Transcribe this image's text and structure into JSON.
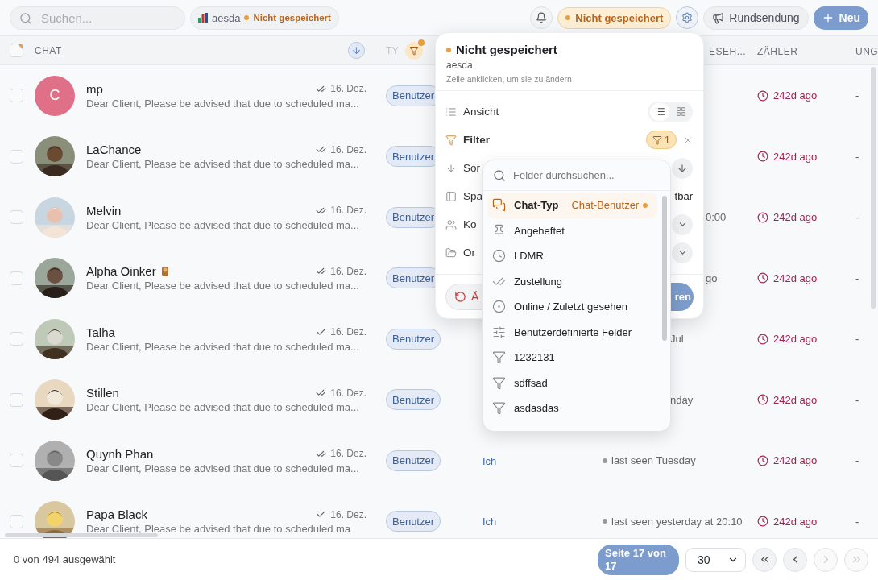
{
  "search": {
    "placeholder": "Suchen..."
  },
  "view_chip": {
    "name": "aesda",
    "status": "Nicht gespeichert"
  },
  "toolbar": {
    "status": "Nicht gespeichert",
    "broadcast": "Rundsendung",
    "new": "Neu"
  },
  "table": {
    "select_all": {
      "checked": false
    },
    "columns": [
      {
        "label": "CHAT"
      },
      {
        "label": "TY"
      },
      {
        "label": "ESEH..."
      },
      {
        "label": "ZÄHLER"
      },
      {
        "label": "UNG"
      }
    ],
    "rows": [
      {
        "checked": false,
        "name": "mp",
        "avatar": {
          "kind": "initial",
          "text": "C",
          "color": "#e07088"
        },
        "sticker": false,
        "double_check": true,
        "date": "16. Dez.",
        "preview": "Dear Client, Please be advised that due to scheduled ma...",
        "type": "Benutzer",
        "counter": "242d ago",
        "unread": "-"
      },
      {
        "checked": false,
        "name": "LaChance",
        "sticker": false,
        "double_check": true,
        "date": "16. Dez.",
        "preview": "Dear Client, Please be advised that due to scheduled ma...",
        "type": "Benutzer",
        "counter": "242d ago",
        "unread": "-"
      },
      {
        "checked": false,
        "name": "Melvin",
        "sticker": false,
        "double_check": true,
        "date": "16. Dez.",
        "preview": "Dear Client, Please be advised that due to scheduled ma...",
        "type": "Benutzer",
        "seen": {
          "text": "0:00",
          "dot": false
        },
        "counter": "242d ago",
        "unread": "-"
      },
      {
        "checked": false,
        "name": "Alpha Oinker",
        "sticker": true,
        "double_check": true,
        "date": "16. Dez.",
        "preview": "Dear Client, Please be advised that due to scheduled ma...",
        "type": "Benutzer",
        "seen": {
          "text": "go",
          "dot": false
        },
        "counter": "242d ago",
        "unread": "-"
      },
      {
        "checked": false,
        "name": "Talha",
        "sticker": false,
        "double_check": false,
        "date": "16. Dez.",
        "preview": "Dear Client, Please be advised that due to scheduled ma...",
        "type": "Benutzer",
        "seen": {
          "text": "Jul",
          "dot": false
        },
        "counter": "242d ago",
        "unread": "-"
      },
      {
        "checked": false,
        "name": "Stillen",
        "sticker": false,
        "double_check": true,
        "date": "16. Dez.",
        "preview": "Dear Client, Please be advised that due to scheduled ma...",
        "type": "Benutzer",
        "seen": {
          "text": "nday",
          "dot": false
        },
        "counter": "242d ago",
        "unread": "-"
      },
      {
        "checked": false,
        "name": "Quynh Phan",
        "sticker": false,
        "double_check": true,
        "date": "16. Dez.",
        "preview": "Dear Client, Please be advised that due to scheduled ma...",
        "type": "Benutzer",
        "me": "Ich",
        "seen": {
          "text": "last seen Tuesday",
          "dot": true
        },
        "counter": "242d ago",
        "unread": "-"
      },
      {
        "checked": false,
        "name": "Papa Black",
        "sticker": false,
        "double_check": false,
        "date": "16. Dez.",
        "preview": "Dear Client, Please be advised that due to scheduled ma",
        "type": "Benutzer",
        "me": "Ich",
        "seen": {
          "text": "last seen yesterday at 20:10",
          "dot": true
        },
        "counter": "242d ago",
        "unread": "-"
      }
    ]
  },
  "popover": {
    "title": "Nicht gespeichert",
    "subtitle": "aesda",
    "hint": "Zeile anklicken, um sie zu ändern",
    "rows": [
      {
        "kind": "view",
        "label": "Ansicht",
        "options": [
          {
            "kind": "list",
            "selected": true
          },
          {
            "kind": "grid",
            "selected": false
          }
        ]
      },
      {
        "kind": "filter",
        "label": "Filter",
        "count": "1"
      },
      {
        "kind": "sort",
        "label": "Sor"
      },
      {
        "kind": "columns",
        "label": "Spa",
        "value": "tbar"
      },
      {
        "kind": "contacts",
        "label": "Ko"
      },
      {
        "kind": "folder",
        "label": "Or"
      }
    ],
    "discard": "Ä",
    "apply": "ren"
  },
  "field_menu": {
    "placeholder": "Felder durchsuchen...",
    "items": [
      {
        "kind": "chat",
        "label": "Chat-Typ",
        "value": "Chat-Benutzer",
        "selected": true
      },
      {
        "kind": "pin",
        "label": "Angeheftet",
        "selected": false
      },
      {
        "kind": "clock",
        "label": "LDMR",
        "selected": false
      },
      {
        "kind": "check",
        "label": "Zustellung",
        "selected": false
      },
      {
        "kind": "online",
        "label": "Online / Zuletzt gesehen",
        "selected": false
      },
      {
        "kind": "sliders",
        "label": "Benutzerdefinierte Felder",
        "selected": false
      },
      {
        "kind": "filter",
        "label": "1232131",
        "selected": false
      },
      {
        "kind": "filter",
        "label": "sdffsad",
        "selected": false
      },
      {
        "kind": "filter",
        "label": "asdasdas",
        "selected": false
      }
    ]
  },
  "footer": {
    "selection": "0 von 494 ausgewählt",
    "page": "Seite 17 von 17",
    "page_size": "30",
    "pager": [
      {
        "kind": "first",
        "disabled": false
      },
      {
        "kind": "prev",
        "disabled": false
      },
      {
        "kind": "next",
        "disabled": true
      },
      {
        "kind": "last",
        "disabled": true
      }
    ]
  }
}
